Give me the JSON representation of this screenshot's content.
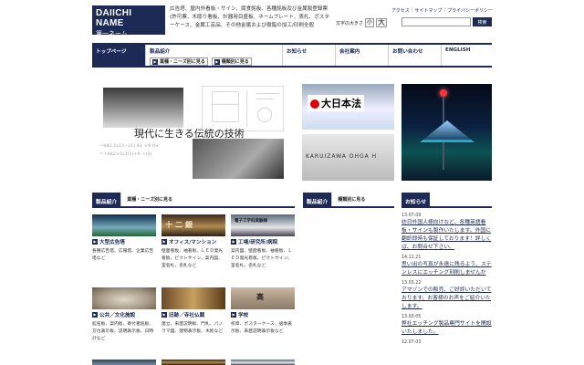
{
  "header": {
    "logo_en": "DAIICHI NAME",
    "logo_jp": "第一ネーム",
    "tagline": "広告塔、屋内外看板・サイン、腐食銘板、各種銘板及び金属製登録票(許可票、木彫り看板、計器用目盛板、ネームプレート、表札、ポスターケース、金属工芸品、その他金属および樹脂の加工/印刷全般",
    "top_links": [
      "アクセス",
      "サイトマップ",
      "プライバシーポリシー"
    ],
    "font_size_label": "文字の大きさ",
    "font_small": "小",
    "font_large": "大",
    "search_placeholder": "",
    "search_button": "検索"
  },
  "nav": {
    "items": [
      {
        "label": "トップページ",
        "active": true
      },
      {
        "label": "製品紹介",
        "subs": [
          "業種・ニーズ別に見る",
          "種類別に見る"
        ]
      },
      {
        "label": "お知らせ"
      },
      {
        "label": "会社案内"
      },
      {
        "label": "お問い合わせ"
      },
      {
        "label": "ENGLISH"
      }
    ]
  },
  "hero": {
    "caption": "現代に生きる伝統の技術",
    "formula": [
      "=442.1(23÷21) 41 <4 8×",
      "=+4d2×5(3/2)+8 ÷(2)"
    ],
    "sign1_text": "大日本法",
    "sign2_text": "KARUIZAWA OHGA H"
  },
  "sections": {
    "products1_title": "製品紹介",
    "products1_tab": "業種・ニーズ別に見る",
    "products2_title": "製品紹介",
    "products2_tab": "種類別に見る",
    "news_title": "お知らせ"
  },
  "products": [
    {
      "title": "大型広告塔",
      "desc": "各種広告塔、広報塔、企業広告塔など"
    },
    {
      "title": "オフィス/マンション",
      "desc": "壁面看板、袖看板、ＬＥＤ発光看板、ピクトサイン、案内図、室名札、名札など"
    },
    {
      "title": "工場/研究所/病院",
      "desc": "案内図、壁面看板、袖看板、ＬＥＤ発光看板、ピクトサイン、室名札、名札など"
    },
    {
      "title": "公共／文化施設",
      "desc": "館名板、案内板、寄付者銘板、方位表示板、説明表示板、日時計など"
    },
    {
      "title": "旧跡／寺社仏閣",
      "desc": "建立、来歴説明板、門札、パノラマ図、建物表示板、木彫など"
    },
    {
      "title": "学校",
      "desc": "校章、ポスターケース、語季表示板、来歴説明表示板など"
    }
  ],
  "product_sign_texts": [
    "十二銀",
    "高",
    "電子工学科実験棟"
  ],
  "news": [
    {
      "date": "13.07.09",
      "text": "訪日外国人様向けなど、各種英語看板・サインも製作いたします。外国に翻訳即時も保証しております！詳しくは、お問合せ下さい。"
    },
    {
      "date": "14.11.21",
      "text": "思い出の写真が永遠に残るよう、ステンレスにエッチング刻刷しませんか"
    },
    {
      "date": "13.03.22",
      "text": "アマゾンでの販売、ご好評いただいております。お客様のお声をご紹介いたします。"
    },
    {
      "date": "13.03.05",
      "text": "弊社エッチング製品専門サイトを開設いたしました。"
    },
    {
      "date": "12.07.03",
      "text": ""
    }
  ]
}
